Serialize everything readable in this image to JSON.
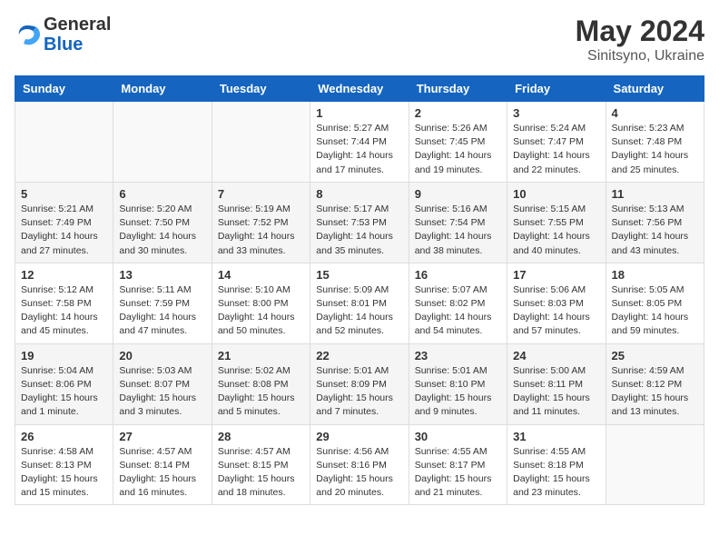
{
  "header": {
    "logo_general": "General",
    "logo_blue": "Blue",
    "month": "May 2024",
    "location": "Sinitsyno, Ukraine"
  },
  "weekdays": [
    "Sunday",
    "Monday",
    "Tuesday",
    "Wednesday",
    "Thursday",
    "Friday",
    "Saturday"
  ],
  "weeks": [
    [
      {
        "day": "",
        "info": ""
      },
      {
        "day": "",
        "info": ""
      },
      {
        "day": "",
        "info": ""
      },
      {
        "day": "1",
        "info": "Sunrise: 5:27 AM\nSunset: 7:44 PM\nDaylight: 14 hours\nand 17 minutes."
      },
      {
        "day": "2",
        "info": "Sunrise: 5:26 AM\nSunset: 7:45 PM\nDaylight: 14 hours\nand 19 minutes."
      },
      {
        "day": "3",
        "info": "Sunrise: 5:24 AM\nSunset: 7:47 PM\nDaylight: 14 hours\nand 22 minutes."
      },
      {
        "day": "4",
        "info": "Sunrise: 5:23 AM\nSunset: 7:48 PM\nDaylight: 14 hours\nand 25 minutes."
      }
    ],
    [
      {
        "day": "5",
        "info": "Sunrise: 5:21 AM\nSunset: 7:49 PM\nDaylight: 14 hours\nand 27 minutes."
      },
      {
        "day": "6",
        "info": "Sunrise: 5:20 AM\nSunset: 7:50 PM\nDaylight: 14 hours\nand 30 minutes."
      },
      {
        "day": "7",
        "info": "Sunrise: 5:19 AM\nSunset: 7:52 PM\nDaylight: 14 hours\nand 33 minutes."
      },
      {
        "day": "8",
        "info": "Sunrise: 5:17 AM\nSunset: 7:53 PM\nDaylight: 14 hours\nand 35 minutes."
      },
      {
        "day": "9",
        "info": "Sunrise: 5:16 AM\nSunset: 7:54 PM\nDaylight: 14 hours\nand 38 minutes."
      },
      {
        "day": "10",
        "info": "Sunrise: 5:15 AM\nSunset: 7:55 PM\nDaylight: 14 hours\nand 40 minutes."
      },
      {
        "day": "11",
        "info": "Sunrise: 5:13 AM\nSunset: 7:56 PM\nDaylight: 14 hours\nand 43 minutes."
      }
    ],
    [
      {
        "day": "12",
        "info": "Sunrise: 5:12 AM\nSunset: 7:58 PM\nDaylight: 14 hours\nand 45 minutes."
      },
      {
        "day": "13",
        "info": "Sunrise: 5:11 AM\nSunset: 7:59 PM\nDaylight: 14 hours\nand 47 minutes."
      },
      {
        "day": "14",
        "info": "Sunrise: 5:10 AM\nSunset: 8:00 PM\nDaylight: 14 hours\nand 50 minutes."
      },
      {
        "day": "15",
        "info": "Sunrise: 5:09 AM\nSunset: 8:01 PM\nDaylight: 14 hours\nand 52 minutes."
      },
      {
        "day": "16",
        "info": "Sunrise: 5:07 AM\nSunset: 8:02 PM\nDaylight: 14 hours\nand 54 minutes."
      },
      {
        "day": "17",
        "info": "Sunrise: 5:06 AM\nSunset: 8:03 PM\nDaylight: 14 hours\nand 57 minutes."
      },
      {
        "day": "18",
        "info": "Sunrise: 5:05 AM\nSunset: 8:05 PM\nDaylight: 14 hours\nand 59 minutes."
      }
    ],
    [
      {
        "day": "19",
        "info": "Sunrise: 5:04 AM\nSunset: 8:06 PM\nDaylight: 15 hours\nand 1 minute."
      },
      {
        "day": "20",
        "info": "Sunrise: 5:03 AM\nSunset: 8:07 PM\nDaylight: 15 hours\nand 3 minutes."
      },
      {
        "day": "21",
        "info": "Sunrise: 5:02 AM\nSunset: 8:08 PM\nDaylight: 15 hours\nand 5 minutes."
      },
      {
        "day": "22",
        "info": "Sunrise: 5:01 AM\nSunset: 8:09 PM\nDaylight: 15 hours\nand 7 minutes."
      },
      {
        "day": "23",
        "info": "Sunrise: 5:01 AM\nSunset: 8:10 PM\nDaylight: 15 hours\nand 9 minutes."
      },
      {
        "day": "24",
        "info": "Sunrise: 5:00 AM\nSunset: 8:11 PM\nDaylight: 15 hours\nand 11 minutes."
      },
      {
        "day": "25",
        "info": "Sunrise: 4:59 AM\nSunset: 8:12 PM\nDaylight: 15 hours\nand 13 minutes."
      }
    ],
    [
      {
        "day": "26",
        "info": "Sunrise: 4:58 AM\nSunset: 8:13 PM\nDaylight: 15 hours\nand 15 minutes."
      },
      {
        "day": "27",
        "info": "Sunrise: 4:57 AM\nSunset: 8:14 PM\nDaylight: 15 hours\nand 16 minutes."
      },
      {
        "day": "28",
        "info": "Sunrise: 4:57 AM\nSunset: 8:15 PM\nDaylight: 15 hours\nand 18 minutes."
      },
      {
        "day": "29",
        "info": "Sunrise: 4:56 AM\nSunset: 8:16 PM\nDaylight: 15 hours\nand 20 minutes."
      },
      {
        "day": "30",
        "info": "Sunrise: 4:55 AM\nSunset: 8:17 PM\nDaylight: 15 hours\nand 21 minutes."
      },
      {
        "day": "31",
        "info": "Sunrise: 4:55 AM\nSunset: 8:18 PM\nDaylight: 15 hours\nand 23 minutes."
      },
      {
        "day": "",
        "info": ""
      }
    ]
  ]
}
